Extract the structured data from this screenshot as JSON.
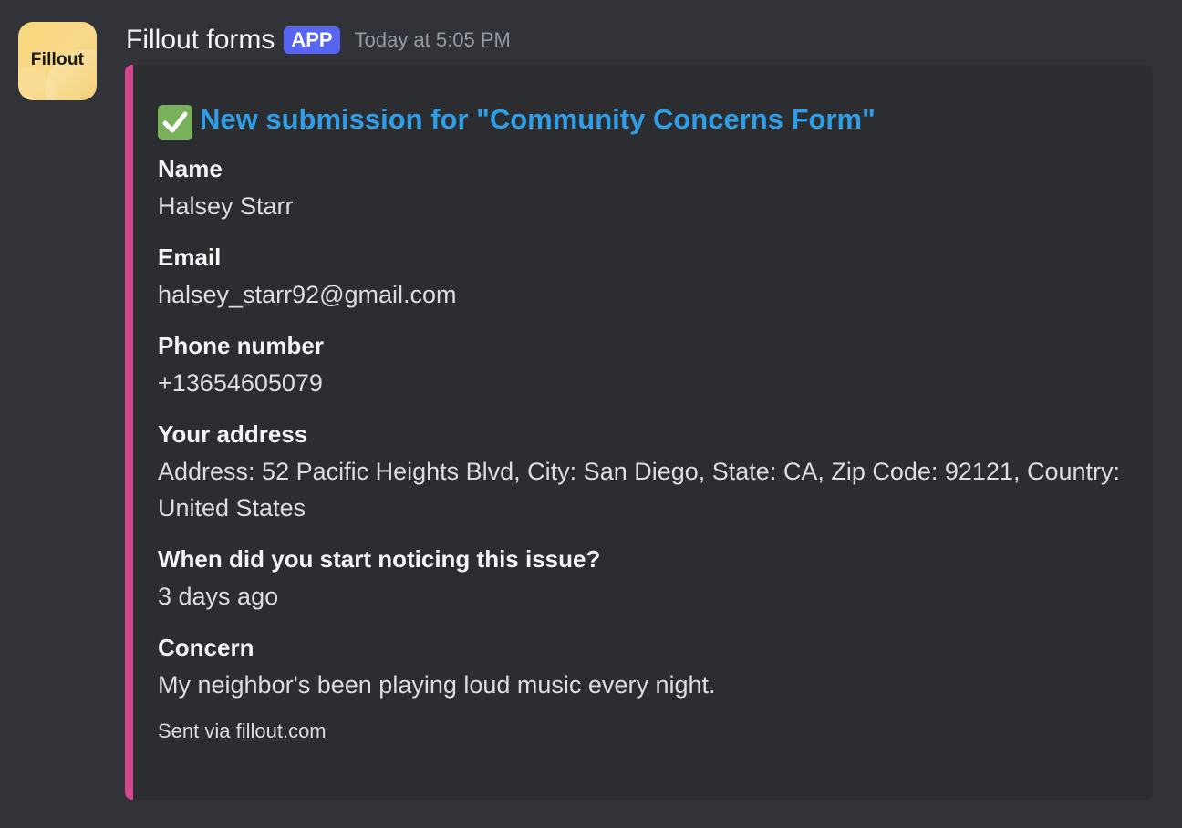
{
  "author": {
    "avatar_text": "Fillout",
    "name": "Fillout forms",
    "badge": "APP",
    "timestamp": "Today at 5:05 PM"
  },
  "embed": {
    "accent_color": "#d4478f",
    "title_icon": "check-mark-icon",
    "title": "New submission for \"Community Concerns Form\"",
    "fields": [
      {
        "name": "Name",
        "value": "Halsey Starr"
      },
      {
        "name": "Email",
        "value": "halsey_starr92@gmail.com"
      },
      {
        "name": "Phone number",
        "value": "+13654605079"
      },
      {
        "name": "Your address",
        "value": "Address: 52 Pacific Heights Blvd, City: San Diego, State: CA, Zip Code: 92121, Country: United States"
      },
      {
        "name": "When did you start noticing this issue?",
        "value": "3 days ago"
      },
      {
        "name": "Concern",
        "value": "My neighbor's been playing loud music every night."
      }
    ],
    "footer": "Sent via fillout.com"
  }
}
